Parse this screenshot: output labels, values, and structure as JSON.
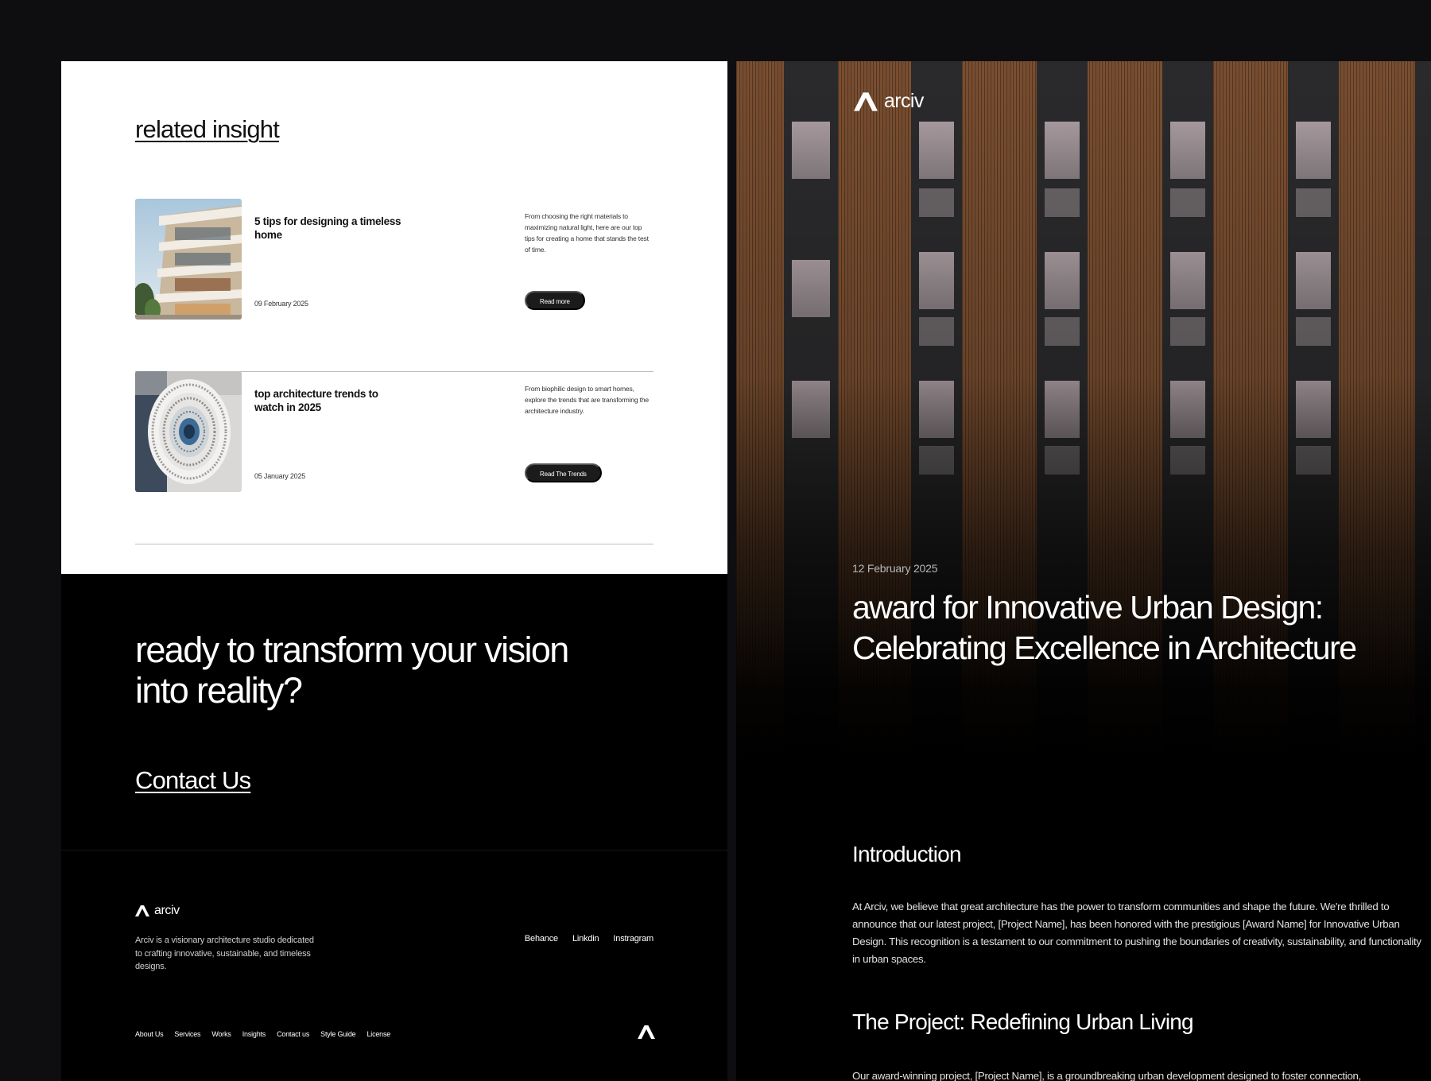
{
  "related": {
    "title": "related insight",
    "cards": [
      {
        "heading": "5 tips for designing a timeless home",
        "date": "09 February 2025",
        "description": "From choosing the right materials to maximizing natural light, here are our top tips for creating a home that stands the test of time.",
        "button_label": "Read more",
        "image": "modern-house-photo"
      },
      {
        "heading": "top architecture trends to watch in 2025",
        "date": "05 January 2025",
        "description": "From biophilic design to smart homes, explore the trends that are transforming the architecture industry.",
        "button_label": "Read The Trends",
        "image": "spiral-staircase-photo"
      }
    ]
  },
  "cta": {
    "heading": "ready to transform your vision into reality?",
    "link_label": "Contact Us"
  },
  "footer": {
    "brand": "arciv",
    "description": "Arciv is a visionary architecture studio dedicated to crafting innovative, sustainable, and timeless designs.",
    "social": [
      "Behance",
      "Linkdin",
      "Instragram"
    ],
    "nav": [
      "About Us",
      "Services",
      "Works",
      "Insights",
      "Contact us",
      "Style Guide",
      "License"
    ]
  },
  "article": {
    "brand": "arciv",
    "date": "12 February 2025",
    "title": "award for Innovative Urban Design: Celebrating Excellence in Architecture",
    "intro_heading": "Introduction",
    "intro_body": "At Arciv, we believe that great architecture has the power to transform communities and shape the future. We're thrilled to announce that our latest project, [Project Name], has been honored with the prestigious [Award Name] for Innovative Urban Design. This recognition is a testament to our commitment to pushing the boundaries of creativity, sustainability, and functionality in urban spaces.",
    "project_heading": "The Project: Redefining Urban Living",
    "project_body": "Our award-winning project, [Project Name], is a groundbreaking urban development designed to foster connection,",
    "hero_image": "wooden-facade-building-photo"
  },
  "colors": {
    "page_bg": "#0e0e10",
    "panel_dark": "#000000",
    "card_bg": "#ffffff",
    "button_bg": "#1b1b1b",
    "text_light": "#ffffff"
  }
}
